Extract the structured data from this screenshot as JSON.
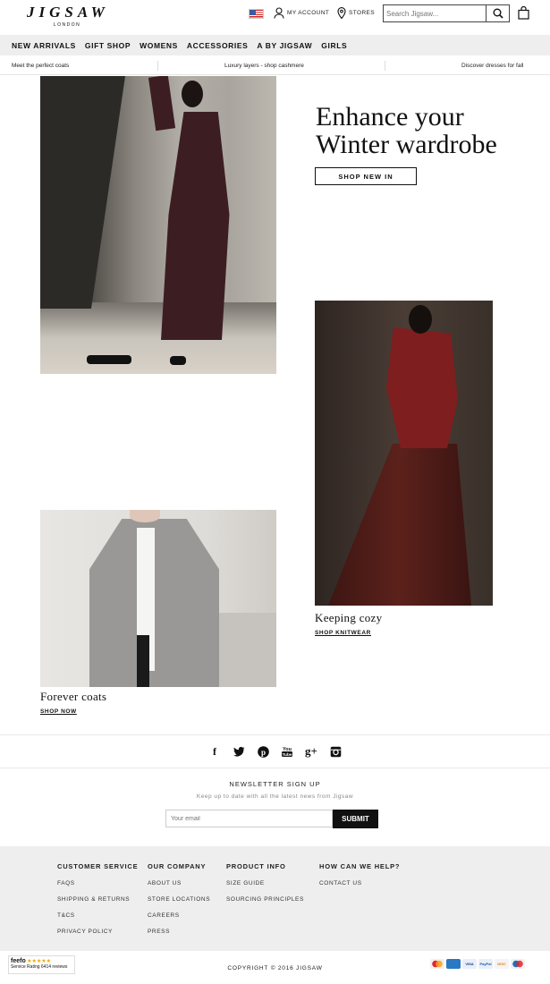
{
  "header": {
    "logo": "JIGSAW",
    "logo_sub": "LONDON",
    "flag_icon": "us-flag-icon",
    "account_label": "MY ACCOUNT",
    "stores_label": "STORES",
    "search_placeholder": "Search Jigsaw..."
  },
  "nav": {
    "items": [
      "NEW ARRIVALS",
      "GIFT SHOP",
      "WOMENS",
      "ACCESSORIES",
      "A BY JIGSAW",
      "GIRLS"
    ]
  },
  "promo": {
    "items": [
      "Meet the perfect coats",
      "Luxury layers - shop cashmere",
      "Discover dresses for fall"
    ]
  },
  "hero": {
    "title_line1": "Enhance your",
    "title_line2": "Winter wardrobe",
    "cta": "SHOP NEW IN"
  },
  "tiles": [
    {
      "caption": "Keeping cozy",
      "link": "SHOP KNITWEAR"
    },
    {
      "caption": "Forever coats",
      "link": "SHOP NOW"
    }
  ],
  "social": {
    "icons": [
      "facebook-icon",
      "twitter-icon",
      "pinterest-icon",
      "youtube-icon",
      "google-plus-icon",
      "instagram-icon"
    ]
  },
  "newsletter": {
    "title": "NEWSLETTER SIGN UP",
    "subtitle": "Keep up to date with all the latest news from Jigsaw",
    "placeholder": "Your email",
    "button": "SUBMIT"
  },
  "footer": {
    "columns": [
      {
        "heading": "CUSTOMER SERVICE",
        "links": [
          "FAQS",
          "SHIPPING & RETURNS",
          "T&CS",
          "PRIVACY POLICY"
        ]
      },
      {
        "heading": "OUR COMPANY",
        "links": [
          "ABOUT US",
          "STORE LOCATIONS",
          "CAREERS",
          "PRESS"
        ]
      },
      {
        "heading": "PRODUCT INFO",
        "links": [
          "SIZE GUIDE",
          "SOURCING PRINCIPLES"
        ]
      },
      {
        "heading": "HOW CAN WE HELP?",
        "links": [
          "CONTACT US"
        ]
      }
    ]
  },
  "bottom": {
    "feefo_brand": "feefo",
    "feefo_label": "Service Rating",
    "feefo_reviews": "6414 reviews",
    "feefo_stars": "★★★★★",
    "copyright": "COPYRIGHT © 2016 JIGSAW",
    "payment_icons": [
      "mastercard-icon",
      "amex-icon",
      "visa-icon",
      "paypal-icon",
      "discover-icon",
      "maestro-icon"
    ]
  }
}
